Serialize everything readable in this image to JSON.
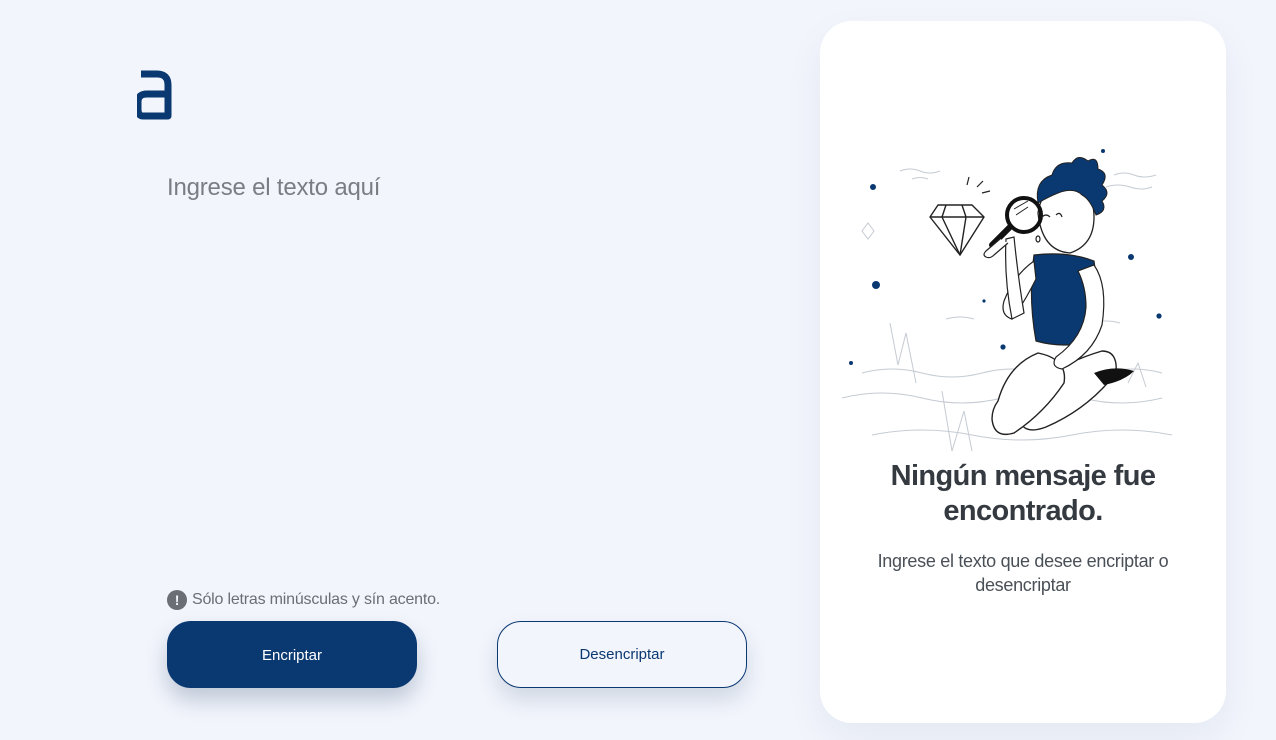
{
  "logo": {
    "letter": "a",
    "icon": "alura-logo-icon",
    "color": "#0a3871"
  },
  "input": {
    "placeholder": "Ingrese el texto aquí",
    "value": ""
  },
  "warning": {
    "icon": "exclamation-icon",
    "text": "Sólo letras minúsculas y sín acento."
  },
  "buttons": {
    "encrypt": "Encriptar",
    "decrypt": "Desencriptar"
  },
  "output": {
    "illustration": "person-with-magnifying-glass-illustration",
    "title": "Ningún mensaje fue encontrado.",
    "description": "Ingrese el texto que desee encriptar o desencriptar"
  },
  "colors": {
    "background": "#f2f5fc",
    "primary": "#0a3871",
    "card": "#ffffff",
    "text_dark": "#343a40",
    "text_muted": "#495057"
  }
}
